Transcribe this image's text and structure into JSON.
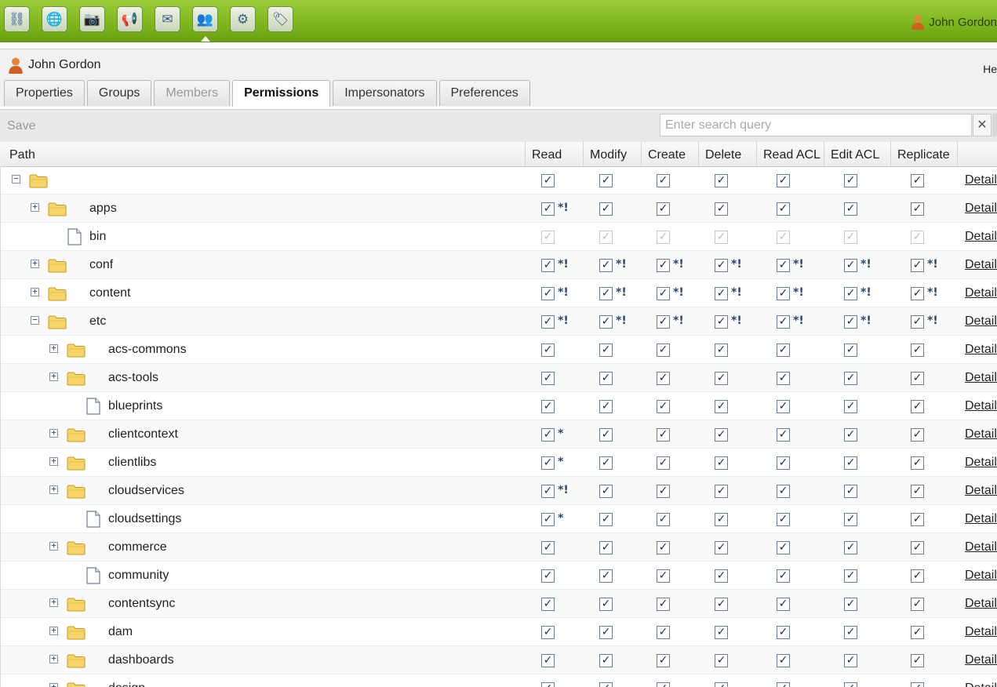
{
  "toolbar": {
    "buttons": [
      "sites-icon",
      "globe-icon",
      "camera-icon",
      "megaphone-icon",
      "mail-icon",
      "users-icon",
      "gears-icon",
      "tag-icon"
    ],
    "active_index": 5,
    "user_name": "John Gordon"
  },
  "header": {
    "user_name": "John Gordon",
    "help_label": "He"
  },
  "tabs": [
    {
      "label": "Properties",
      "state": "normal"
    },
    {
      "label": "Groups",
      "state": "normal"
    },
    {
      "label": "Members",
      "state": "disabled"
    },
    {
      "label": "Permissions",
      "state": "selected"
    },
    {
      "label": "Impersonators",
      "state": "normal"
    },
    {
      "label": "Preferences",
      "state": "normal"
    }
  ],
  "actionbar": {
    "save_label": "Save",
    "search_placeholder": "Enter search query",
    "clear_label": "✕"
  },
  "columns": {
    "path": "Path",
    "permissions": [
      "Read",
      "Modify",
      "Create",
      "Delete",
      "Read ACL",
      "Edit ACL",
      "Replicate"
    ]
  },
  "detail_label": "Details",
  "rows": [
    {
      "name": "",
      "level": 0,
      "type": "folder",
      "toggle": "minus",
      "perms": [
        "",
        "",
        "",
        "",
        "",
        "",
        ""
      ]
    },
    {
      "name": "apps",
      "level": 1,
      "type": "folder",
      "toggle": "plus",
      "perms": [
        "*!",
        "",
        "",
        "",
        "",
        "",
        ""
      ]
    },
    {
      "name": "bin",
      "level": 1,
      "type": "file",
      "toggle": "none",
      "disabled": true,
      "perms": [
        "",
        "",
        "",
        "",
        "",
        "",
        ""
      ]
    },
    {
      "name": "conf",
      "level": 1,
      "type": "folder",
      "toggle": "plus",
      "perms": [
        "*!",
        "*!",
        "*!",
        "*!",
        "*!",
        "*!",
        "*!"
      ]
    },
    {
      "name": "content",
      "level": 1,
      "type": "folder",
      "toggle": "plus",
      "perms": [
        "*!",
        "*!",
        "*!",
        "*!",
        "*!",
        "*!",
        "*!"
      ]
    },
    {
      "name": "etc",
      "level": 1,
      "type": "folder",
      "toggle": "minus",
      "perms": [
        "*!",
        "*!",
        "*!",
        "*!",
        "*!",
        "*!",
        "*!"
      ]
    },
    {
      "name": "acs-commons",
      "level": 2,
      "type": "folder",
      "toggle": "plus",
      "perms": [
        "",
        "",
        "",
        "",
        "",
        "",
        ""
      ]
    },
    {
      "name": "acs-tools",
      "level": 2,
      "type": "folder",
      "toggle": "plus",
      "perms": [
        "",
        "",
        "",
        "",
        "",
        "",
        ""
      ]
    },
    {
      "name": "blueprints",
      "level": 2,
      "type": "file",
      "toggle": "none",
      "perms": [
        "",
        "",
        "",
        "",
        "",
        "",
        ""
      ]
    },
    {
      "name": "clientcontext",
      "level": 2,
      "type": "folder",
      "toggle": "plus",
      "perms": [
        "*",
        "",
        "",
        "",
        "",
        "",
        ""
      ]
    },
    {
      "name": "clientlibs",
      "level": 2,
      "type": "folder",
      "toggle": "plus",
      "perms": [
        "*",
        "",
        "",
        "",
        "",
        "",
        ""
      ]
    },
    {
      "name": "cloudservices",
      "level": 2,
      "type": "folder",
      "toggle": "plus",
      "perms": [
        "*!",
        "",
        "",
        "",
        "",
        "",
        ""
      ]
    },
    {
      "name": "cloudsettings",
      "level": 2,
      "type": "file",
      "toggle": "none",
      "perms": [
        "*",
        "",
        "",
        "",
        "",
        "",
        ""
      ]
    },
    {
      "name": "commerce",
      "level": 2,
      "type": "folder",
      "toggle": "plus",
      "perms": [
        "",
        "",
        "",
        "",
        "",
        "",
        ""
      ]
    },
    {
      "name": "community",
      "level": 2,
      "type": "file",
      "toggle": "none",
      "perms": [
        "",
        "",
        "",
        "",
        "",
        "",
        ""
      ]
    },
    {
      "name": "contentsync",
      "level": 2,
      "type": "folder",
      "toggle": "plus",
      "perms": [
        "",
        "",
        "",
        "",
        "",
        "",
        ""
      ]
    },
    {
      "name": "dam",
      "level": 2,
      "type": "folder",
      "toggle": "plus",
      "perms": [
        "",
        "",
        "",
        "",
        "",
        "",
        ""
      ]
    },
    {
      "name": "dashboards",
      "level": 2,
      "type": "folder",
      "toggle": "plus",
      "perms": [
        "",
        "",
        "",
        "",
        "",
        "",
        ""
      ]
    },
    {
      "name": "design",
      "level": 2,
      "type": "folder",
      "toggle": "plus",
      "perms": [
        "",
        "",
        "",
        "",
        "",
        "",
        ""
      ]
    }
  ]
}
